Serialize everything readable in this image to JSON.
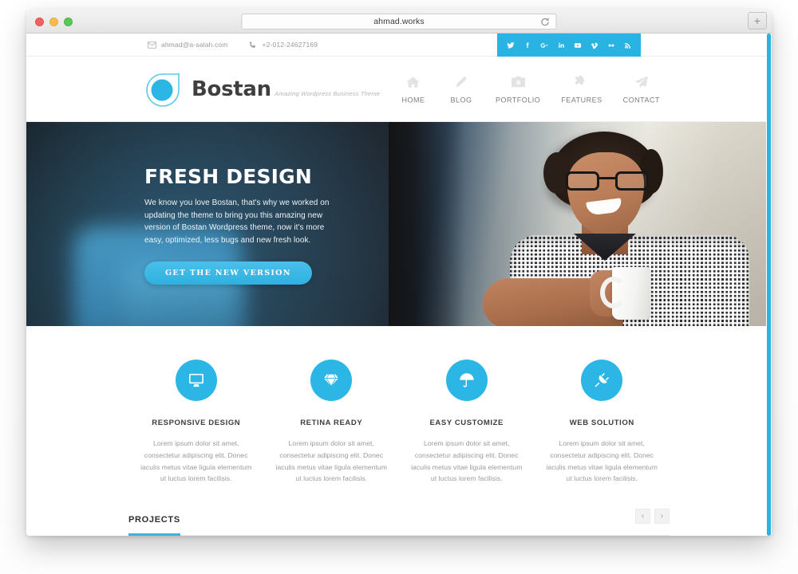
{
  "browser": {
    "url": "ahmad.works",
    "reload_icon": "reload-icon",
    "newtab_label": "+",
    "lights": [
      "close",
      "minimize",
      "maximize"
    ]
  },
  "topbar": {
    "email": "ahmad@a-salah.com",
    "phone": "+2-012-24627169",
    "social": [
      {
        "name": "twitter",
        "glyph": "twitter-icon"
      },
      {
        "name": "facebook",
        "glyph": "facebook-icon"
      },
      {
        "name": "google-plus",
        "glyph": "google-plus-icon"
      },
      {
        "name": "linkedin",
        "glyph": "linkedin-icon"
      },
      {
        "name": "youtube",
        "glyph": "youtube-icon"
      },
      {
        "name": "vimeo",
        "glyph": "vimeo-icon"
      },
      {
        "name": "flickr",
        "glyph": "flickr-icon"
      },
      {
        "name": "rss",
        "glyph": "rss-icon"
      }
    ]
  },
  "header": {
    "brand": "Bostan",
    "tagline": "Amazing Wordpress Business Theme",
    "nav": [
      {
        "label": "HOME",
        "icon": "home-icon"
      },
      {
        "label": "BLOG",
        "icon": "pencil-icon"
      },
      {
        "label": "PORTFOLIO",
        "icon": "camera-icon"
      },
      {
        "label": "FEATURES",
        "icon": "puzzle-icon"
      },
      {
        "label": "CONTACT",
        "icon": "paper-plane-icon"
      }
    ]
  },
  "hero": {
    "title": "FRESH DESIGN",
    "subtitle": "We know you love Bostan, that's why we worked on updating the theme to bring you this amazing new version of Bostan Wordpress theme, now it's more easy, optimized, less bugs and new fresh look.",
    "cta": "GET THE NEW VERSION"
  },
  "features": [
    {
      "icon": "monitor-icon",
      "title": "RESPONSIVE DESIGN",
      "text": "Lorem ipsum dolor sit amet, consectetur adipiscing elit. Donec iaculis metus vitae ligula elementum ut luctus lorem facilisis."
    },
    {
      "icon": "diamond-icon",
      "title": "RETINA READY",
      "text": "Lorem ipsum dolor sit amet, consectetur adipiscing elit. Donec iaculis metus vitae ligula elementum ut luctus lorem facilisis."
    },
    {
      "icon": "umbrella-icon",
      "title": "EASY CUSTOMIZE",
      "text": "Lorem ipsum dolor sit amet, consectetur adipiscing elit. Donec iaculis metus vitae ligula elementum ut luctus lorem facilisis."
    },
    {
      "icon": "plug-icon",
      "title": "WEB SOLUTION",
      "text": "Lorem ipsum dolor sit amet, consectetur adipiscing elit. Donec iaculis metus vitae ligula elementum ut luctus lorem facilisis."
    }
  ],
  "projects": {
    "title": "PROJECTS",
    "prev": "‹",
    "next": "›"
  },
  "colors": {
    "accent": "#2cb6e6",
    "accent_dark": "#29b3e3",
    "underline": "#36b6e4",
    "text_dark": "#3d3d3d",
    "text_muted": "#9b9b9b"
  }
}
